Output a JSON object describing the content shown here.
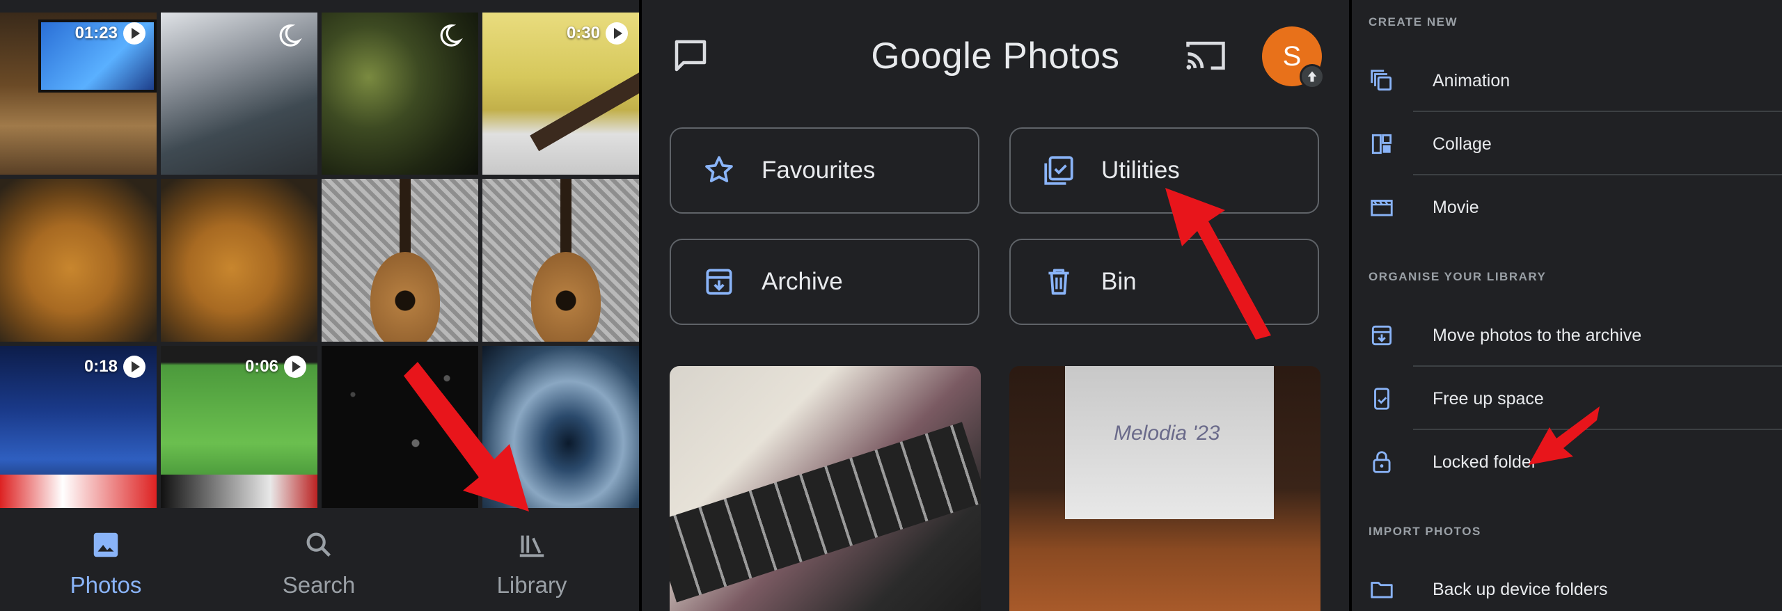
{
  "left_panel": {
    "tiles": [
      {
        "kind": "video",
        "duration": "01:23"
      },
      {
        "kind": "night"
      },
      {
        "kind": "night"
      },
      {
        "kind": "video",
        "duration": "0:30"
      },
      {
        "kind": "photo"
      },
      {
        "kind": "photo"
      },
      {
        "kind": "photo"
      },
      {
        "kind": "photo"
      },
      {
        "kind": "video",
        "duration": "0:18"
      },
      {
        "kind": "video",
        "duration": "0:06"
      },
      {
        "kind": "photo"
      },
      {
        "kind": "photo"
      }
    ],
    "nav": {
      "photos_label": "Photos",
      "search_label": "Search",
      "library_label": "Library"
    }
  },
  "middle_panel": {
    "app_title": "Google Photos",
    "avatar_letter": "S",
    "chips": {
      "favourites": "Favourites",
      "utilities": "Utilities",
      "archive": "Archive",
      "bin": "Bin"
    },
    "photo_b_text": "Melodia '23"
  },
  "right_panel": {
    "create_new_heading": "CREATE NEW",
    "create_items": {
      "animation": "Animation",
      "collage": "Collage",
      "movie": "Movie"
    },
    "organise_heading": "ORGANISE YOUR LIBRARY",
    "organise_items": {
      "archive": "Move photos to the archive",
      "free_space": "Free up space",
      "locked": "Locked folder"
    },
    "import_heading": "IMPORT PHOTOS",
    "import_items": {
      "backup": "Back up device folders"
    }
  },
  "colors": {
    "background": "#202124",
    "active_blue": "#8ab4f8",
    "icon_blue": "#8ab4f8",
    "arrow_red": "#e8151b",
    "avatar_orange": "#e8711a"
  }
}
